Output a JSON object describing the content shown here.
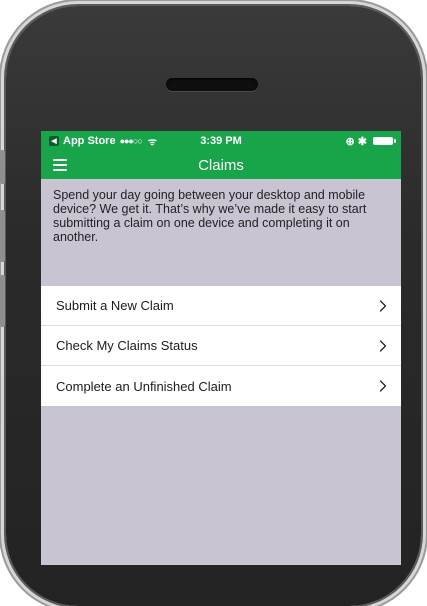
{
  "status_bar": {
    "back_app": "App Store",
    "signal": "●●●○○",
    "wifi": "ᯤ",
    "time": "3:39 PM",
    "right_icons": "⊕ ✱"
  },
  "nav": {
    "title": "Claims"
  },
  "intro_text": "Spend your day going between your desktop and mobile device? We get it. That’s why we’ve made it easy to start submitting a claim on one device and completing it on another.",
  "menu": {
    "items": [
      {
        "label": "Submit a New Claim"
      },
      {
        "label": "Check My Claims Status"
      },
      {
        "label": "Complete an Unfinished Claim"
      }
    ]
  },
  "colors": {
    "brand_green": "#18a54a",
    "content_background": "#c9c4d2"
  }
}
